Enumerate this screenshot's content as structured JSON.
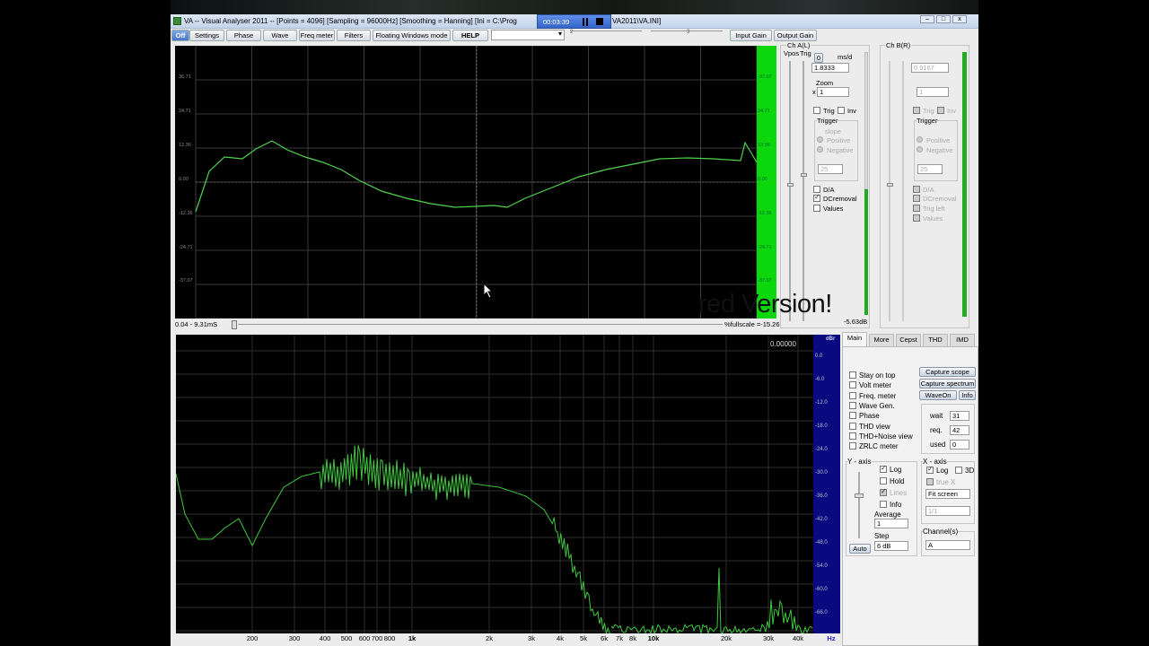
{
  "window": {
    "title": "VA -- Visual Analyser 2011 --  [Points = 4096]  [Sampling = 96000Hz]  [Smoothing = Hanning]  [Ini = C:\\Prog",
    "title_tail": "VA2011\\VA.INI]",
    "media_time": "00:03:39"
  },
  "toolbar": {
    "buttons": [
      "Off",
      "Settings",
      "Phase",
      "Wave",
      "Freq meter",
      "Filters",
      "Floating Windows mode",
      "HELP"
    ],
    "right_buttons": [
      "Input Gain",
      "Output Gain"
    ],
    "ruler_marks": [
      "2",
      "3"
    ]
  },
  "scope": {
    "y_labels": [
      "36.71",
      "24.71",
      "12.36",
      "0.00",
      "-12.36",
      "-24.71",
      "-37.07"
    ],
    "right_labels": [
      "-37.07",
      "24.71",
      "12.36",
      "0.00",
      "-12.36",
      "-24.71",
      "-37.07"
    ],
    "time_range": "0.04 - 9.31mS",
    "fullscale": "%fullscale =-15.26"
  },
  "chA": {
    "title": "Ch A(L)",
    "vpos": "Vpos",
    "trig": "Trig",
    "zero_btn": "0",
    "ms_label": "ms/d",
    "ms_value": "1.8333",
    "zoom_label": "Zoom",
    "zoom_prefix": "x",
    "zoom_value": "1",
    "trig_cb": "Trig",
    "inv_cb": "Inv",
    "trigger_group": "Trigger",
    "slope": "slope",
    "positive": "Positive",
    "negative": "Negative",
    "threshold_value": "25",
    "da": "D/A",
    "dcremoval": "DCremoval",
    "values": "Values",
    "level": "-5.63dB"
  },
  "chB": {
    "title": "Ch B(R)",
    "ms_value": "0.9167",
    "zoom_value": "1",
    "trig_cb": "Trig",
    "inv_cb": "Inv",
    "trigger_group": "Trigger",
    "positive": "Positive",
    "negative": "Negative",
    "threshold_value": "25",
    "da": "D/A",
    "dcremoval": "DCremoval",
    "trigleft": "Trig left",
    "values": "Values"
  },
  "watermark": "red Version!",
  "spectrum": {
    "reading": "0.00000",
    "db_title": "dBr",
    "db_labels": [
      "0.0",
      "-6.0",
      "-12.0",
      "-18.0",
      "-24.0",
      "-30.0",
      "-36.0",
      "-42.0",
      "-48.0",
      "-54.0",
      "-60.0",
      "-66.0"
    ],
    "x_labels": [
      "200",
      "300",
      "400",
      "500",
      "600",
      "700",
      "800",
      "1k",
      "2k",
      "3k",
      "4k",
      "5k",
      "6k",
      "7k",
      "8k",
      "10k",
      "20k",
      "30k",
      "40k"
    ],
    "hz": "Hz"
  },
  "panel": {
    "tabs": [
      "Main",
      "More",
      "Cepst",
      "THD",
      "IMD"
    ],
    "checks": [
      "Stay on top",
      "Volt meter",
      "Freq. meter",
      "Wave Gen.",
      "Phase",
      "THD view",
      "THD+Noise view",
      "ZRLC meter"
    ],
    "capture_scope": "Capture scope",
    "capture_spectrum": "Capture spectrum",
    "waveon": "WaveOn",
    "info": "Info",
    "wait_label": "wait",
    "wait_value": "31",
    "req_label": "req.",
    "req_value": "42",
    "used_label": "used",
    "used_value": "0",
    "yaxis": "Y - axis",
    "xaxis": "X - axis",
    "y_log": "Log",
    "y_hold": "Hold",
    "y_lines": "Lines",
    "y_info": "Info",
    "average_label": "Average",
    "average_value": "1",
    "step_label": "Step",
    "step_value": "6 dB",
    "auto": "Auto",
    "x_log": "Log",
    "x_3d": "3D",
    "x_truex": "true X",
    "fit_screen": "Fit screen",
    "fft_value": "1/1",
    "channels": "Channel(s)",
    "channel_value": "A"
  }
}
